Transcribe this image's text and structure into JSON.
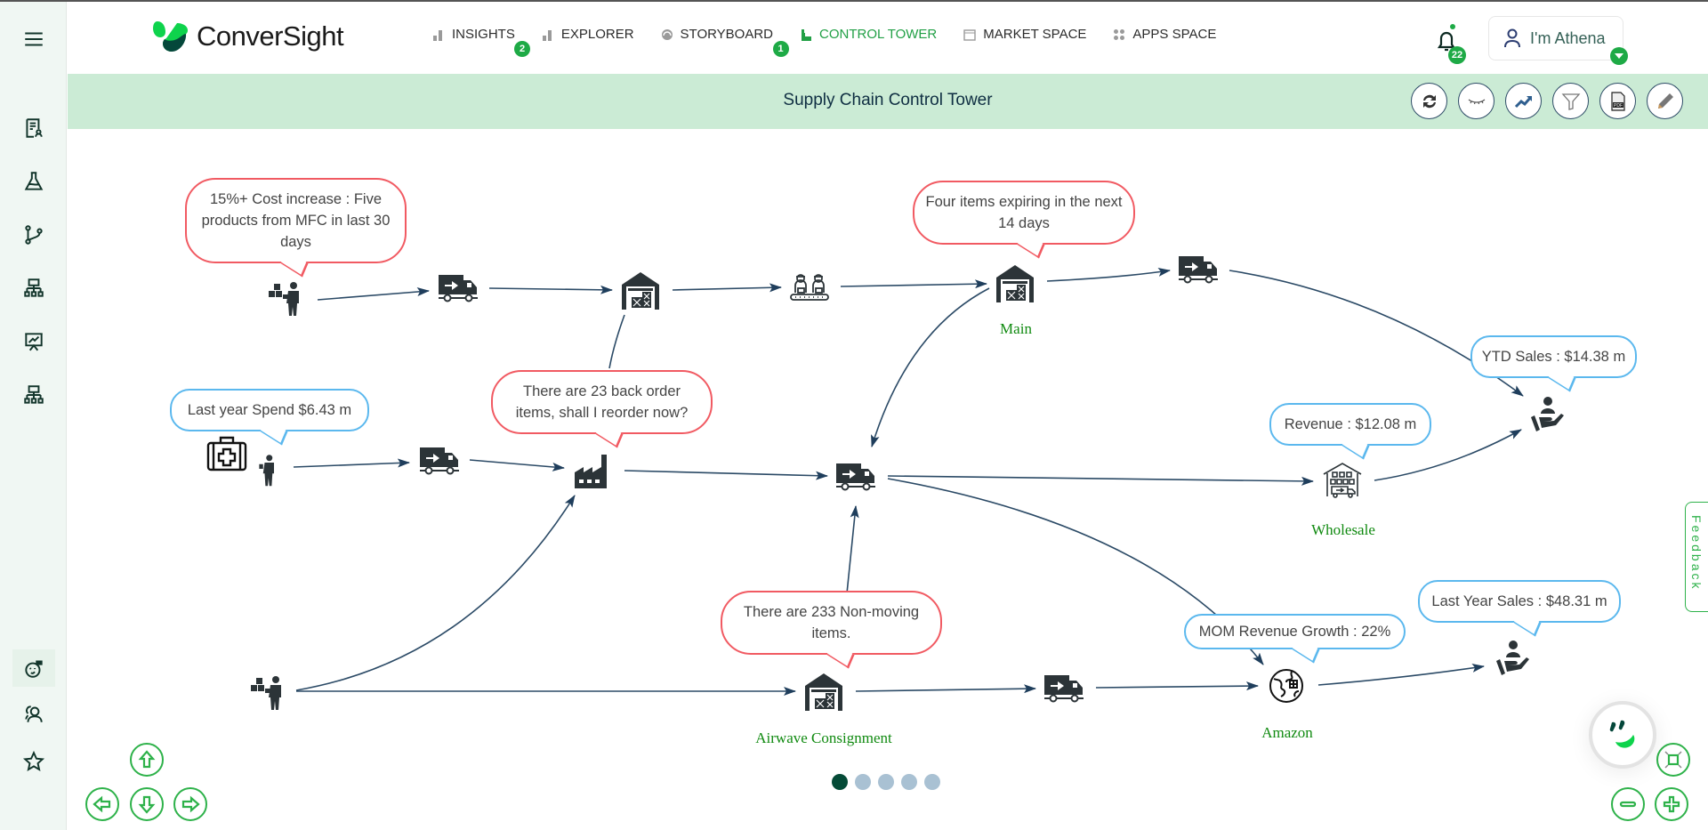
{
  "app": {
    "name": "ConverSight"
  },
  "nav": {
    "items": [
      {
        "label": "INSIGHTS",
        "icon": "bar-chart-icon",
        "badge": "2"
      },
      {
        "label": "EXPLORER",
        "icon": "bar-chart-icon"
      },
      {
        "label": "STORYBOARD",
        "icon": "gauge-icon",
        "badge": "1"
      },
      {
        "label": "CONTROL TOWER",
        "icon": "tower-icon",
        "active": true
      },
      {
        "label": "MARKET SPACE",
        "icon": "store-icon"
      },
      {
        "label": "APPS SPACE",
        "icon": "grid-icon"
      }
    ]
  },
  "notifications": {
    "count": "22"
  },
  "user": {
    "label": "I'm Athena"
  },
  "page": {
    "title": "Supply Chain Control Tower"
  },
  "toolbar": [
    "refresh",
    "hide",
    "trend",
    "filter",
    "pdf-export",
    "edit"
  ],
  "sidebar": {
    "top": [
      "document-user",
      "flask",
      "branch",
      "hierarchy",
      "presentation-chart",
      "hierarchy"
    ],
    "bottom": [
      "bot-assistant",
      "users",
      "favorites"
    ]
  },
  "diagram": {
    "bubbles": {
      "cost_increase": "15%+ Cost increase : Five products from MFC in last 30 days",
      "expiring": "Four items expiring in the next 14 days",
      "ly_spend": "Last year Spend $6.43 m",
      "back_order": "There are 23 back order items, shall I reorder now?",
      "ytd_sales": "YTD Sales : $14.38 m",
      "revenue": "Revenue : $12.08 m",
      "non_moving": "There are 233 Non-moving items.",
      "mom_growth": "MOM Revenue Growth : 22%",
      "ly_sales": "Last Year Sales : $48.31 m"
    },
    "labels": {
      "main": "Main",
      "wholesale": "Wholesale",
      "airwave": "Airwave Consignment",
      "amazon": "Amazon"
    }
  },
  "pagination": {
    "pages": 5,
    "current": 1
  },
  "feedback": {
    "label": "Feedback"
  },
  "colors": {
    "accent": "#22a046",
    "alert": "#f15a62",
    "info": "#5bb8ee",
    "edge": "#2b4a66",
    "title_bar": "#cbebd5"
  }
}
